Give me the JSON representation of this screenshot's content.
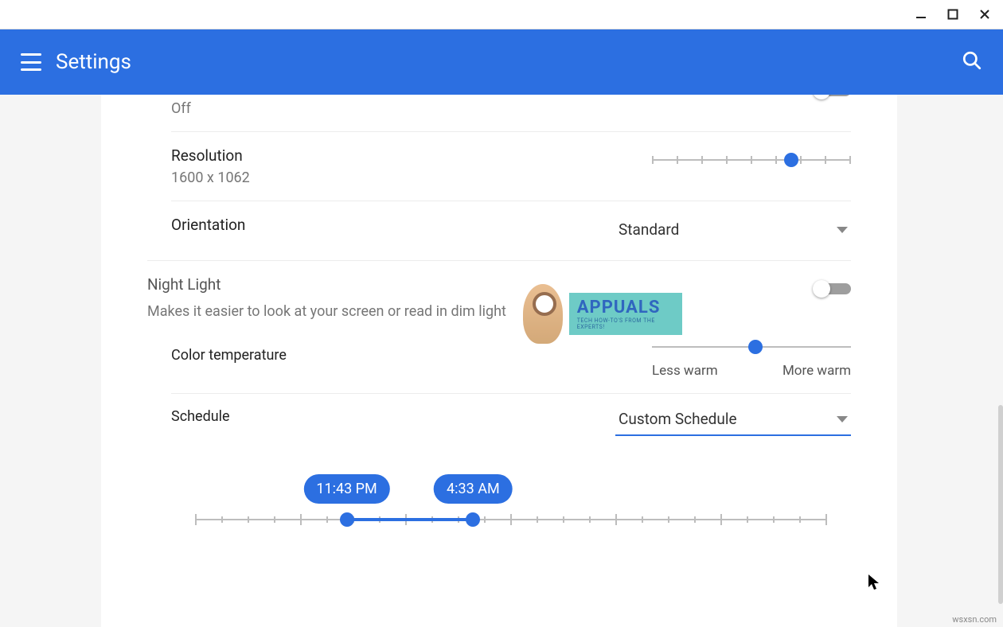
{
  "window": {
    "minimize_icon": "minimize",
    "maximize_icon": "maximize",
    "close_icon": "close"
  },
  "header": {
    "title": "Settings"
  },
  "display": {
    "unknown_toggle_value": "Off",
    "resolution_label": "Resolution",
    "resolution_value": "1600 x 1062",
    "resolution_slider_pct": 70,
    "orientation_label": "Orientation",
    "orientation_value": "Standard"
  },
  "night_light": {
    "title": "Night Light",
    "description": "Makes it easier to look at your screen or read in dim light",
    "toggle_on": false,
    "color_temp_label": "Color temperature",
    "color_temp_pct": 52,
    "less_warm_label": "Less warm",
    "more_warm_label": "More warm",
    "schedule_label": "Schedule",
    "schedule_value": "Custom Schedule",
    "start_time": "11:43 PM",
    "end_time": "4:33 AM",
    "start_pct": 24,
    "end_pct": 44
  },
  "watermark": {
    "brand": "APPUALS",
    "tagline": "TECH HOW-TO'S FROM THE EXPERTS!"
  },
  "footer_site": "wsxsn.com"
}
